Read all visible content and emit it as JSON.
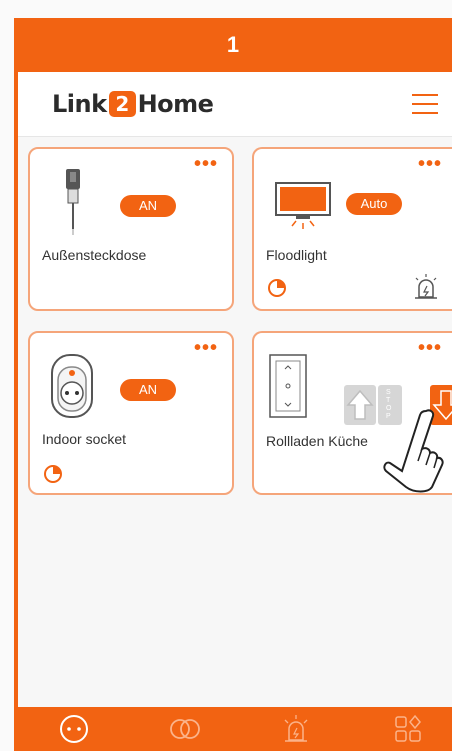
{
  "header": {
    "title": "1"
  },
  "app": {
    "logo_left": "Link",
    "logo_mid": "2",
    "logo_right": "Home"
  },
  "devices": [
    {
      "name": "Außensteckdose",
      "status": "AN"
    },
    {
      "name": "Floodlight",
      "status": "Auto"
    },
    {
      "name": "Indoor socket",
      "status": "AN"
    },
    {
      "name": "Rollladen Küche",
      "stop_label": "STOP"
    }
  ],
  "icons": {
    "menu": "hamburger-menu-icon",
    "more": "more-dots-icon",
    "timer": "timer-icon",
    "alarm": "alarm-light-icon",
    "nav": [
      "devices-icon",
      "groups-icon",
      "alarm-icon",
      "scenes-icon"
    ]
  },
  "colors": {
    "accent": "#f26312",
    "card_border": "#f5a57a",
    "disabled": "#d6d6d6"
  }
}
